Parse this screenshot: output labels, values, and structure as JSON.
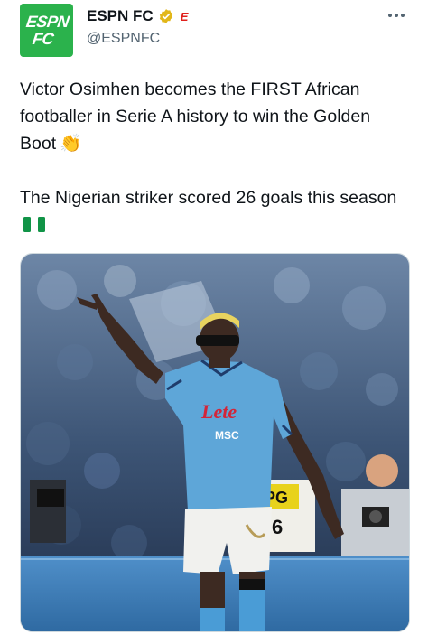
{
  "account": {
    "name": "ESPN FC",
    "handle": "@ESPNFC",
    "avatar_text_line1": "ESPN",
    "avatar_text_line2": "FC",
    "brand_mark": "E",
    "avatar_color": "#2bb24c",
    "verified_icon": "gold-verified-check-icon"
  },
  "tweet": {
    "text_line1": "Victor Osimhen becomes the FIRST African footballer in Serie A history to win the Golden Boot",
    "emoji_1": "👏",
    "text_line2": "The Nigerian striker scored 26 goals this season",
    "flag_icon": "nigeria-flag-icon"
  },
  "media": {
    "kit_sponsor": "Lete",
    "kit_sponsor_2": "MSC",
    "photographer_bib": "PG",
    "photographer_bib_number": "6"
  },
  "colors": {
    "jersey_blue": "#5ea6d8",
    "pitch_blue": "#3d7fb8",
    "text_primary": "#0f1419",
    "text_secondary": "#536471"
  }
}
